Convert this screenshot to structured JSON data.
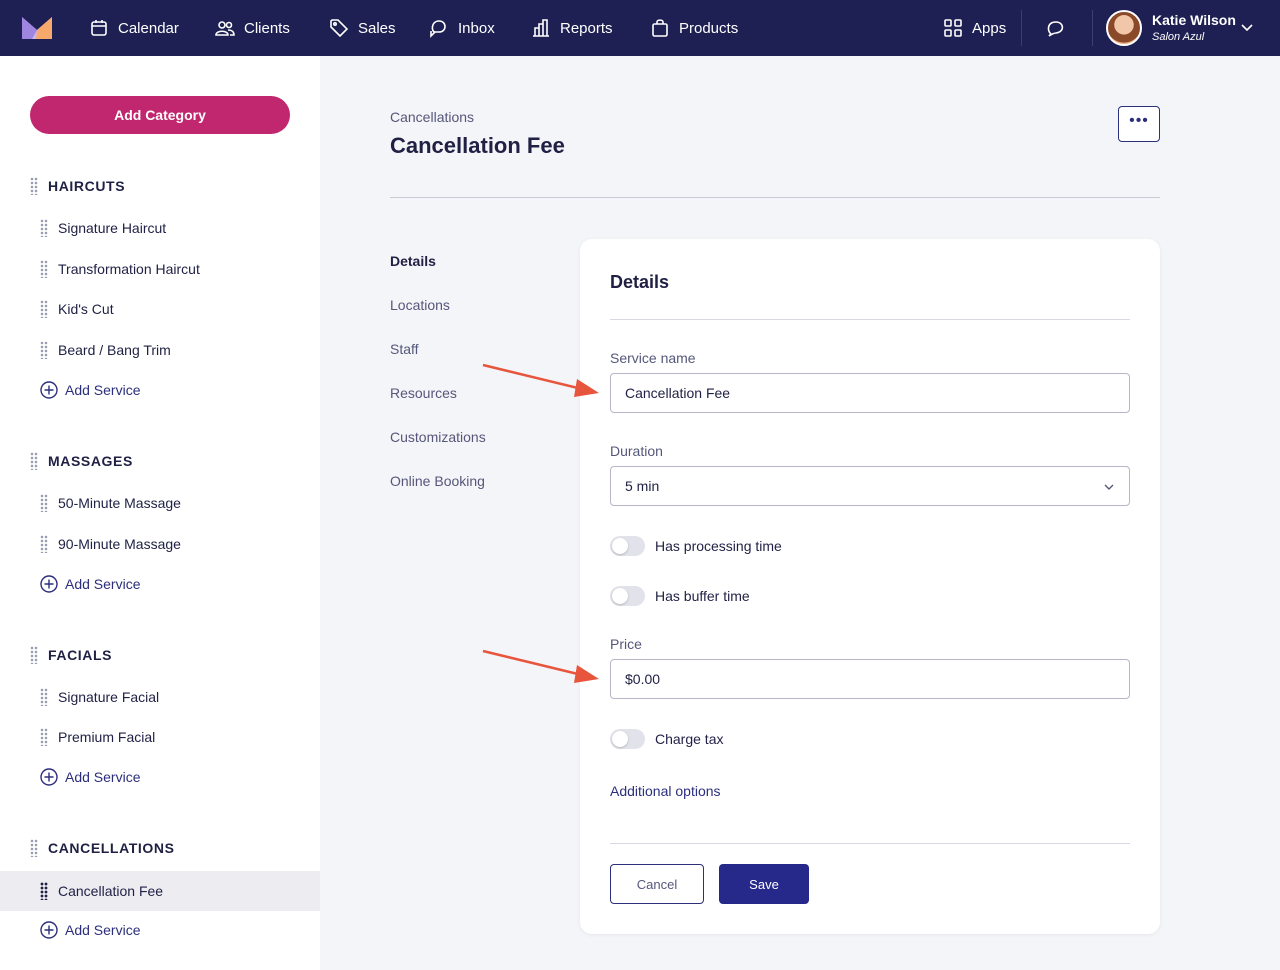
{
  "nav": {
    "items": [
      {
        "label": "Calendar",
        "icon": "calendar-icon"
      },
      {
        "label": "Clients",
        "icon": "clients-icon"
      },
      {
        "label": "Sales",
        "icon": "tag-icon"
      },
      {
        "label": "Inbox",
        "icon": "inbox-icon"
      },
      {
        "label": "Reports",
        "icon": "reports-icon"
      },
      {
        "label": "Products",
        "icon": "bag-icon"
      }
    ],
    "apps_label": "Apps",
    "user": {
      "name": "Katie Wilson",
      "salon": "Salon Azul"
    }
  },
  "sidebar": {
    "add_category": "Add Category",
    "add_service": "Add Service",
    "categories": [
      {
        "name": "HAIRCUTS",
        "services": [
          "Signature Haircut",
          "Transformation Haircut",
          "Kid's Cut",
          "Beard / Bang Trim"
        ]
      },
      {
        "name": "MASSAGES",
        "services": [
          "50-Minute Massage",
          "90-Minute Massage"
        ]
      },
      {
        "name": "FACIALS",
        "services": [
          "Signature Facial",
          "Premium Facial"
        ]
      },
      {
        "name": "CANCELLATIONS",
        "services": [
          "Cancellation Fee"
        ]
      }
    ]
  },
  "main": {
    "breadcrumb": "Cancellations",
    "title": "Cancellation Fee",
    "more": "•••",
    "subnav": [
      "Details",
      "Locations",
      "Staff",
      "Resources",
      "Customizations",
      "Online Booking"
    ]
  },
  "form": {
    "title": "Details",
    "service_name_label": "Service name",
    "service_name_value": "Cancellation Fee",
    "duration_label": "Duration",
    "duration_value": "5 min",
    "processing_label": "Has processing time",
    "buffer_label": "Has buffer time",
    "price_label": "Price",
    "price_value": "$0.00",
    "tax_label": "Charge tax",
    "additional_options": "Additional options",
    "cancel": "Cancel",
    "save": "Save"
  },
  "colors": {
    "nav_bg": "#1e2053",
    "accent": "#c1276e",
    "primary": "#26288a",
    "arrow": "#e8553d"
  }
}
